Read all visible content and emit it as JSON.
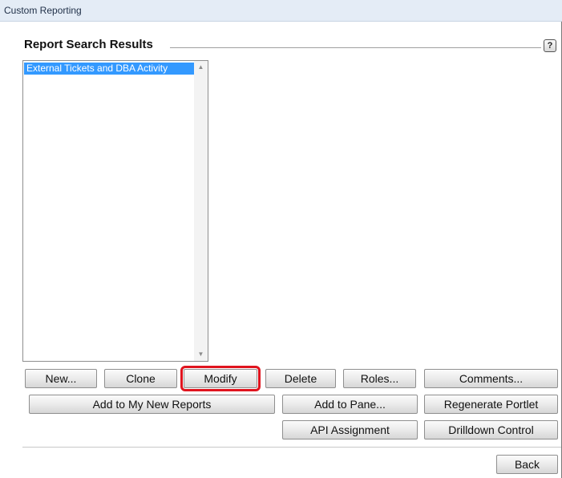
{
  "window": {
    "title": "Custom Reporting"
  },
  "section": {
    "title": "Report Search Results",
    "help_icon": "help-icon"
  },
  "report_list": {
    "items": [
      "External Tickets and DBA Activity"
    ],
    "selected_index": 0
  },
  "buttons": {
    "new": "New...",
    "clone": "Clone",
    "modify": "Modify",
    "delete": "Delete",
    "roles": "Roles...",
    "comments": "Comments...",
    "add_to_my_new_reports": "Add to My New Reports",
    "add_to_pane": "Add to Pane...",
    "regenerate_portlet": "Regenerate Portlet",
    "api_assignment": "API Assignment",
    "drilldown_control": "Drilldown Control",
    "back": "Back"
  },
  "colors": {
    "title_bar": "#e4ecf6",
    "selection": "#3399ff",
    "highlight_outline": "#e0141e"
  }
}
